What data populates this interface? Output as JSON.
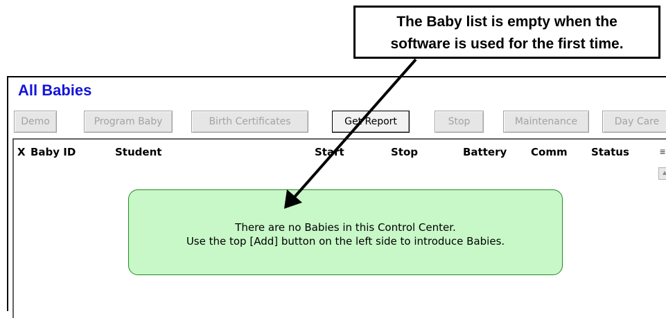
{
  "callout": {
    "line1": "The Baby list is empty when the",
    "line2": "software is used for the first time."
  },
  "window": {
    "title": "All Babies"
  },
  "toolbar": {
    "buttons": [
      {
        "label": "Demo",
        "enabled": false
      },
      {
        "label": "Program Baby",
        "enabled": false
      },
      {
        "label": "Birth Certificates",
        "enabled": false
      },
      {
        "label": "Get Report",
        "enabled": true
      },
      {
        "label": "Stop",
        "enabled": false
      },
      {
        "label": "Maintenance",
        "enabled": false
      },
      {
        "label": "Day Care",
        "enabled": false
      }
    ]
  },
  "list": {
    "columns": [
      "X",
      "Baby ID",
      "Student",
      "Start",
      "Stop",
      "Battery",
      "Comm",
      "Status"
    ],
    "empty_line1": "There are no Babies in this Control Center.",
    "empty_line2": "Use the top [Add] button on the left side to introduce Babies."
  },
  "icons": {
    "sort": "sort-icon",
    "scroll_up": "scroll-up-arrow-icon"
  }
}
